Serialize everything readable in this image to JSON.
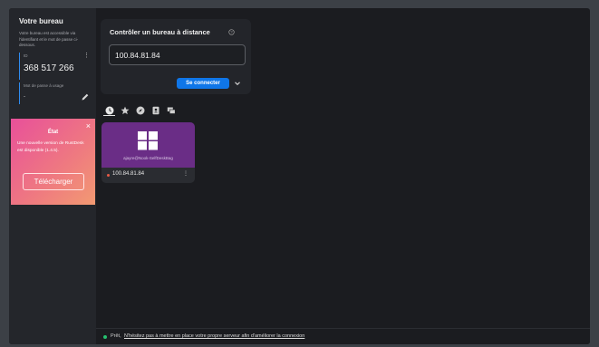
{
  "sidebar": {
    "title": "Votre bureau",
    "description": "Votre bureau est accessible via l'identifiant et le mot de passe ci-dessous.",
    "id_label": "ID",
    "id_menu": "⋮",
    "id_value": "368 517 266",
    "password_label": "Mot de passe à usage",
    "password_value": "-"
  },
  "notice": {
    "title": "État",
    "text": "Une nouvelle version de RustDesk est disponible (1.4.5).",
    "button_label": "Télécharger",
    "close": "×"
  },
  "connect": {
    "title": "Contrôler un bureau à distance",
    "input_value": "100.84.81.84",
    "connect_label": "Se connecter"
  },
  "tabs": [
    {
      "name": "recent-sessions-tab",
      "icon": "clock-icon",
      "active": true
    },
    {
      "name": "favorites-tab",
      "icon": "star-icon"
    },
    {
      "name": "discovered-tab",
      "icon": "compass-icon"
    },
    {
      "name": "address-book-tab",
      "icon": "address-book-icon"
    },
    {
      "name": "group-tab",
      "icon": "group-icon"
    }
  ],
  "peers": [
    {
      "username": "ajayre@Nook-SelfDeskBag",
      "address": "100.84.81.84",
      "menu": "⋮",
      "os": "windows"
    }
  ],
  "status": {
    "ready": "Prêt,",
    "link": "N'hésitez pas à mettre en place votre propre serveur afin d'améliorer la connexion",
    "color": "#25c16f"
  },
  "colors": {
    "accent": "#0f76e8",
    "thumbnail": "#6a2d86",
    "notice_gradient_start": "#e8509a",
    "notice_gradient_end": "#f29a72"
  }
}
